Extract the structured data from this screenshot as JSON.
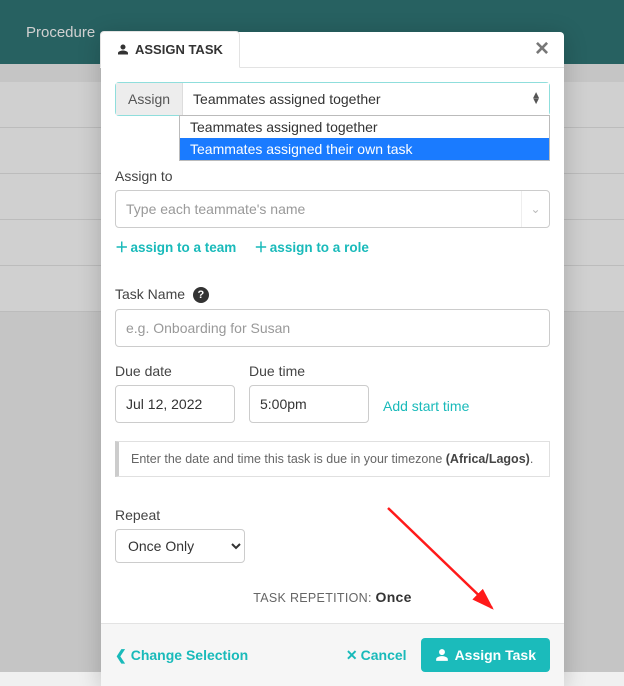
{
  "topbar": {
    "crumb": "Procedure"
  },
  "modal": {
    "tabLabel": "ASSIGN TASK",
    "assign": {
      "label": "Assign",
      "selected": "Teammates assigned together",
      "options": [
        "Teammates assigned together",
        "Teammates assigned their own task"
      ],
      "highlightedIndex": 1
    },
    "assignTo": {
      "label": "Assign to",
      "placeholder": "Type each teammate's name"
    },
    "links": {
      "team": "assign to a team",
      "role": "assign to a role"
    },
    "taskName": {
      "label": "Task Name",
      "placeholder": "e.g. Onboarding for Susan"
    },
    "dueDate": {
      "label": "Due date",
      "value": "Jul 12, 2022"
    },
    "dueTime": {
      "label": "Due time",
      "value": "5:00pm"
    },
    "addStart": "Add start time",
    "tzNote": {
      "prefix": "Enter the date and time this task is due in your timezone ",
      "tz": "(Africa/Lagos)",
      "suffix": "."
    },
    "repeat": {
      "label": "Repeat",
      "value": "Once Only"
    },
    "repetition": {
      "label": "TASK REPETITION: ",
      "value": "Once"
    },
    "footer": {
      "change": "Change Selection",
      "cancel": "Cancel",
      "assign": "Assign Task"
    }
  }
}
